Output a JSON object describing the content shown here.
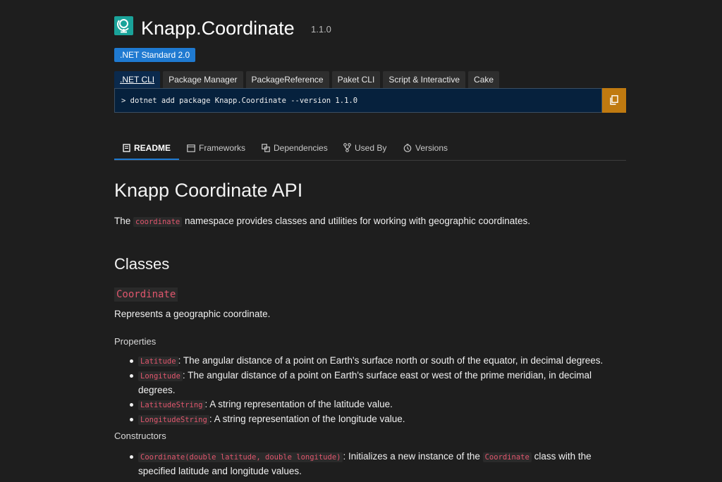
{
  "package": {
    "title": "Knapp.Coordinate",
    "version": "1.1.0",
    "framework_badge": ".NET Standard 2.0",
    "icon": "package-globe-icon"
  },
  "install": {
    "tabs": [
      ".NET CLI",
      "Package Manager",
      "PackageReference",
      "Paket CLI",
      "Script & Interactive",
      "Cake"
    ],
    "active_tab": ".NET CLI",
    "command": "> dotnet add package Knapp.Coordinate --version 1.1.0",
    "copy_icon": "copy-icon"
  },
  "doc_tabs": {
    "readme": "README",
    "frameworks": "Frameworks",
    "dependencies": "Dependencies",
    "used_by": "Used By",
    "versions": "Versions"
  },
  "readme": {
    "h1": "Knapp Coordinate API",
    "intro_pre": "The ",
    "intro_code": "coordinate",
    "intro_post": " namespace provides classes and utilities for working with geographic coordinates.",
    "h2": "Classes",
    "class_name": "Coordinate",
    "class_desc": "Represents a geographic coordinate.",
    "properties_heading": "Properties",
    "properties": [
      {
        "code": "Latitude",
        "text": ": The angular distance of a point on Earth's surface north or south of the equator, in decimal degrees."
      },
      {
        "code": "Longitude",
        "text": ": The angular distance of a point on Earth's surface east or west of the prime meridian, in decimal degrees."
      },
      {
        "code": "LatitudeString",
        "text": ": A string representation of the latitude value."
      },
      {
        "code": "LongitudeString",
        "text": ": A string representation of the longitude value."
      }
    ],
    "constructors_heading": "Constructors",
    "constructor": {
      "code": "Coordinate(double latitude, double longitude)",
      "text_pre": ": Initializes a new instance of the ",
      "code2": "Coordinate",
      "text_post": " class with the specified latitude and longitude values."
    }
  },
  "colors": {
    "background": "#1e1e1e",
    "accent": "#1f7ad1",
    "copy_button": "#c07a10",
    "code": "#e0566d"
  }
}
